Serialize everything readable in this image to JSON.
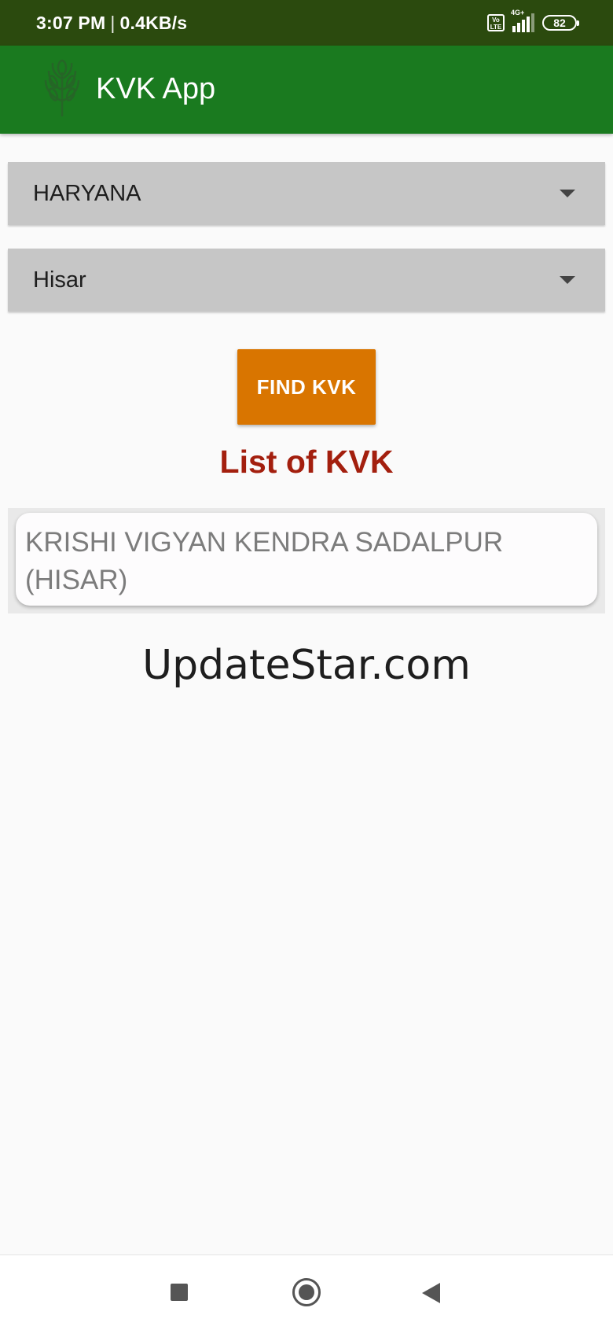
{
  "status_bar": {
    "time": "3:07 PM",
    "separator": "|",
    "network_speed": "0.4KB/s",
    "volte_label": "Vo LTE",
    "network_type": "4G+",
    "battery": "82"
  },
  "app_bar": {
    "title": "KVK App",
    "logo_icon": "kvk-logo-icon",
    "color": "#1a7a1f"
  },
  "state_spinner": {
    "selected": "HARYANA",
    "icon": "dropdown-arrow-icon"
  },
  "district_spinner": {
    "selected": "Hisar",
    "icon": "dropdown-arrow-icon"
  },
  "find_button": {
    "label": "FIND KVK",
    "color": "#d97500"
  },
  "list": {
    "heading": "List of KVK",
    "heading_color": "#a31f0e",
    "items": [
      "KRISHI VIGYAN KENDRA SADALPUR (HISAR)"
    ]
  },
  "watermark": "UpdateStar.com",
  "nav_bar": {
    "recents_icon": "square-icon",
    "home_icon": "circle-icon",
    "back_icon": "triangle-back-icon"
  }
}
